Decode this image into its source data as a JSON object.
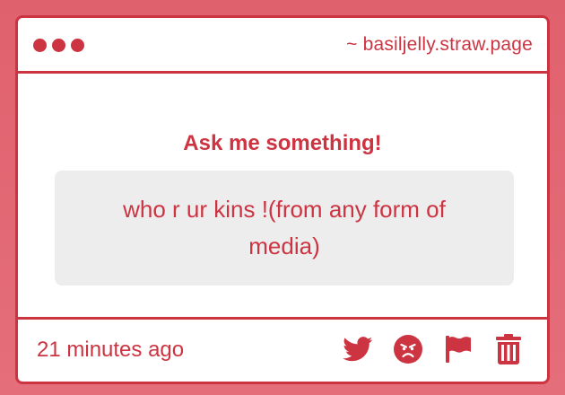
{
  "window": {
    "site_label": "~ basiljelly.straw.page",
    "dot_icons": [
      "dot-icon",
      "dot-icon",
      "dot-icon"
    ]
  },
  "prompt": {
    "heading": "Ask me something!",
    "question": "who r ur kins !(from any form of media)"
  },
  "footer": {
    "timestamp": "21 minutes ago",
    "actions": [
      {
        "name": "share-twitter-button",
        "icon": "twitter-bird-icon"
      },
      {
        "name": "angry-face-button",
        "icon": "angry-face-icon"
      },
      {
        "name": "report-button",
        "icon": "flag-icon"
      },
      {
        "name": "delete-button",
        "icon": "trash-icon"
      }
    ]
  },
  "colors": {
    "accent": "#cd3441",
    "background": "#e0616e",
    "card": "#ffffff",
    "question_box": "#eeedee"
  }
}
